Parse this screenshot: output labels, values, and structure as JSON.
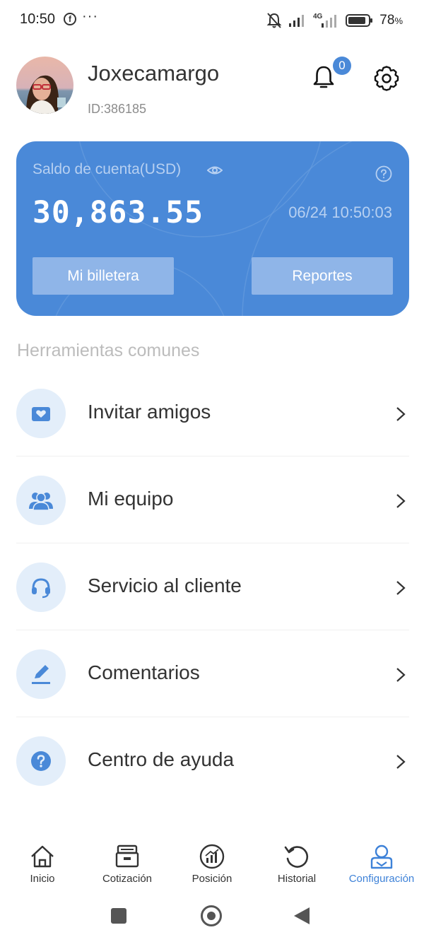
{
  "status_bar": {
    "time": "10:50",
    "fb_glyph": "f",
    "dots": "···",
    "network_label": "4G",
    "battery_percent": "78",
    "battery_percent_suffix": "%",
    "icons": [
      "facebook-notification-icon",
      "more-dots-icon",
      "bell-muted-icon",
      "signal-icon",
      "4g-signal-icon",
      "battery-icon"
    ]
  },
  "profile": {
    "username": "Joxecamargo",
    "id": "ID:386185",
    "notification_count": "0"
  },
  "balance_card": {
    "label": "Saldo de cuenta(USD)",
    "amount": "30,863.55",
    "timestamp": "06/24 10:50:03",
    "wallet_button": "Mi billetera",
    "reports_button": "Reportes",
    "card_color": "#4a89d8"
  },
  "tools": {
    "title": "Herramientas comunes",
    "items": [
      {
        "label": "Invitar amigos",
        "icon": "heart-mail-icon"
      },
      {
        "label": "Mi equipo",
        "icon": "team-icon"
      },
      {
        "label": "Servicio al cliente",
        "icon": "headset-icon"
      },
      {
        "label": "Comentarios",
        "icon": "pen-icon"
      },
      {
        "label": "Centro de ayuda",
        "icon": "question-icon"
      }
    ]
  },
  "bottom_nav": {
    "items": [
      {
        "label": "Inicio",
        "icon": "home-icon",
        "active": false
      },
      {
        "label": "Cotización",
        "icon": "quote-icon",
        "active": false
      },
      {
        "label": "Posición",
        "icon": "position-chart-icon",
        "active": false
      },
      {
        "label": "Historial",
        "icon": "history-icon",
        "active": false
      },
      {
        "label": "Configuración",
        "icon": "profile-settings-icon",
        "active": true
      }
    ],
    "active_color": "#3e82d8"
  }
}
